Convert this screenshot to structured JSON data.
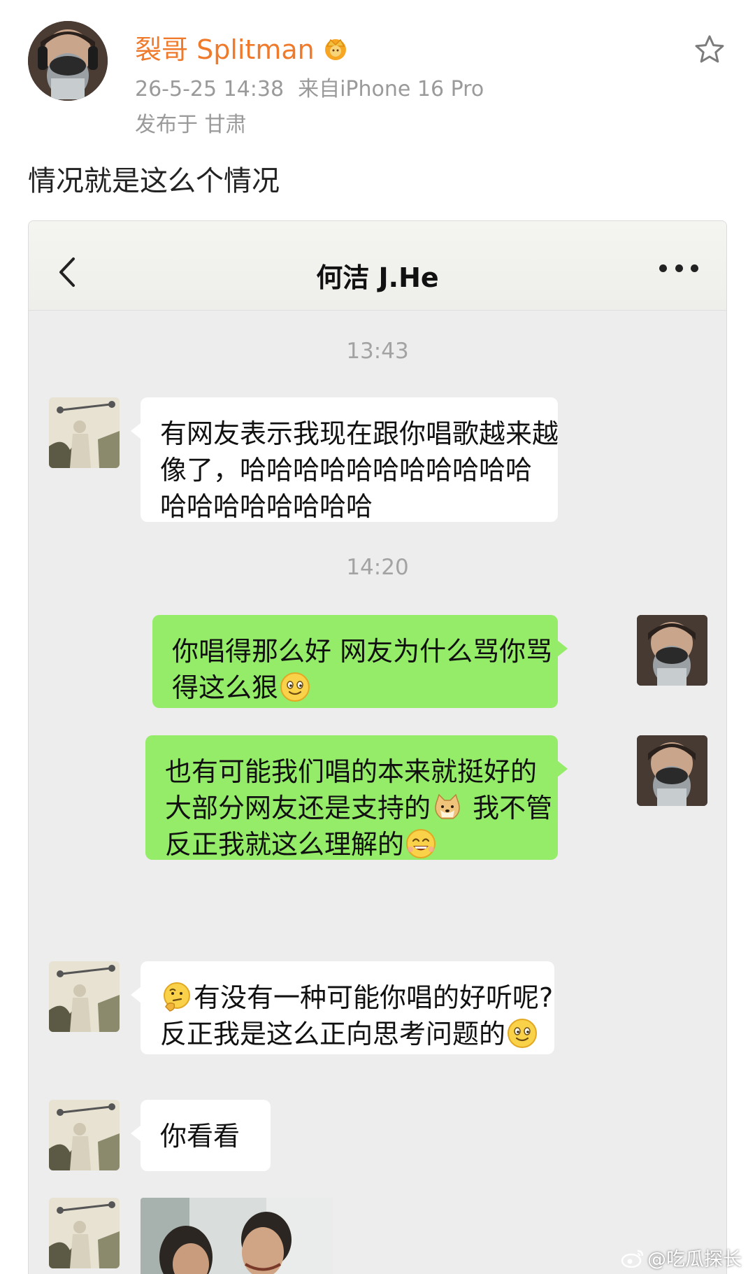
{
  "post": {
    "author": "裂哥 Splitman",
    "time": "26-5-25 14:38",
    "source": "来自iPhone 16 Pro",
    "location": "发布于 甘肃",
    "text": "情况就是这么个情况"
  },
  "chat": {
    "title": "何洁 J.He",
    "timestamps": [
      "13:43",
      "14:20"
    ],
    "messages": [
      {
        "side": "left",
        "lines": [
          "有网友表示我现在跟你唱歌越来越",
          "像了，哈哈哈哈哈哈哈哈哈哈哈",
          "哈哈哈哈哈哈哈哈"
        ]
      },
      {
        "side": "right",
        "lines": [
          "你唱得那么好 网友为什么骂你骂",
          "得这么狠"
        ]
      },
      {
        "side": "right",
        "lines": [
          "也有可能我们唱的本来就挺好的",
          "大部分网友还是支持的",
          "我不管",
          "反正我就这么理解的"
        ]
      },
      {
        "side": "left",
        "lines": [
          "有没有一种可能你唱的好听呢?",
          "反正我是这么正向思考问题的"
        ]
      },
      {
        "side": "left",
        "lines": [
          "你看看"
        ]
      }
    ]
  },
  "icons": {
    "crown": "crown-badge-icon",
    "star": "star-outline-icon",
    "back": "chevron-left-icon",
    "more": "more-dots-icon",
    "weibo": "weibo-logo-icon"
  },
  "colors": {
    "author_name": "#f07a2b",
    "bubble_right": "#95ec69",
    "bubble_left": "#ffffff",
    "chat_background": "#ededed"
  },
  "watermark": "@吃瓜探长"
}
